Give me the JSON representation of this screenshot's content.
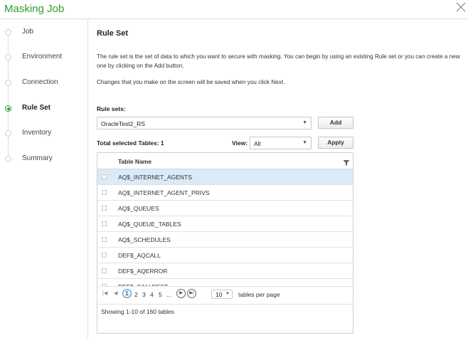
{
  "dialog": {
    "title": "Masking Job"
  },
  "steps": [
    {
      "label": "Job",
      "active": false
    },
    {
      "label": "Environment",
      "active": false
    },
    {
      "label": "Connection",
      "active": false
    },
    {
      "label": "Rule Set",
      "active": true
    },
    {
      "label": "Inventory",
      "active": false
    },
    {
      "label": "Summary",
      "active": false
    }
  ],
  "content": {
    "title": "Rule Set",
    "description": "The rule set is the set of data to which you want to secure with masking. You can begin by using an existing Rule set or you can create a new one by clicking on the Add button.",
    "note": "Changes that you make on the screen will be saved when you click Next.",
    "rule_sets_label": "Rule sets:",
    "rule_set_value": "OracleTest2_RS",
    "add_label": "Add",
    "total_selected": "Total selected Tables: 1",
    "view_label": "View:",
    "view_value": "All",
    "apply_label": "Apply"
  },
  "table": {
    "header": "Table Name",
    "rows": [
      {
        "name": "AQ$_INTERNET_AGENTS",
        "selected": true
      },
      {
        "name": "AQ$_INTERNET_AGENT_PRIVS",
        "selected": false
      },
      {
        "name": "AQ$_QUEUES",
        "selected": false
      },
      {
        "name": "AQ$_QUEUE_TABLES",
        "selected": false
      },
      {
        "name": "AQ$_SCHEDULES",
        "selected": false
      },
      {
        "name": "DEF$_AQCALL",
        "selected": false
      },
      {
        "name": "DEF$_AQERROR",
        "selected": false
      },
      {
        "name": "DEF$_CALLDEST",
        "selected": false
      }
    ]
  },
  "pagination": {
    "current": "1",
    "pages": [
      "2",
      "3",
      "4",
      "5",
      "..."
    ],
    "per_page_value": "10",
    "per_page_label": "tables per page",
    "summary": "Showing 1-10 of 160 tables"
  },
  "colors": {
    "accent": "#2e9a2e",
    "selection": "#dbeaf7"
  }
}
